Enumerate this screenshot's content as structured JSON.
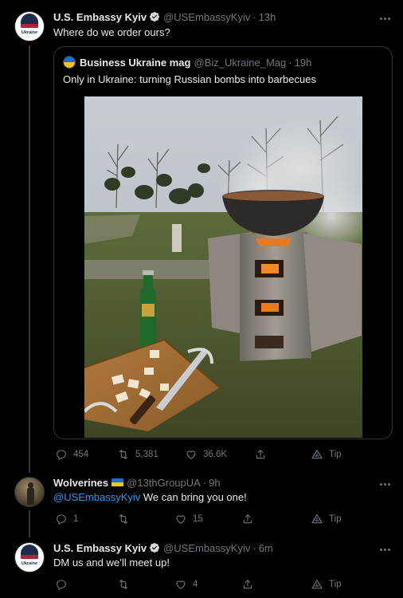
{
  "tweets": [
    {
      "name": "U.S. Embassy Kyiv",
      "handle": "@USEmbassyKyiv",
      "time": "13h",
      "text": "Where do we order ours?",
      "avatar_badge": "Ukraine",
      "quote": {
        "name": "Business Ukraine mag",
        "handle": "@Biz_Ukraine_Mag",
        "time": "19h",
        "text": "Only in Ukraine: turning Russian bombs into barbecues",
        "image": "photo-bomb-barbecue"
      },
      "stats": {
        "replies": "454",
        "retweets": "5,381",
        "likes": "36.6K",
        "tip": "Tip"
      }
    },
    {
      "name": "Wolverines",
      "handle": "@13thGroupUA",
      "time": "9h",
      "mention": "@USEmbassyKyiv",
      "text": " We can bring you one!",
      "stats": {
        "replies": "1",
        "retweets": "",
        "likes": "15",
        "tip": "Tip"
      }
    },
    {
      "name": "U.S. Embassy Kyiv",
      "handle": "@USEmbassyKyiv",
      "time": "6m",
      "text": "DM us and we’ll meet up!",
      "avatar_badge": "Ukraine",
      "stats": {
        "replies": "",
        "retweets": "",
        "likes": "4",
        "tip": "Tip"
      }
    }
  ],
  "colors": {
    "background": "#000000",
    "text": "#e7e9ea",
    "muted": "#71767b",
    "accent": "#1d9bf0",
    "verified": "#1d9bf0",
    "flag_blue": "#1d6fd8",
    "flag_yellow": "#f3c613"
  },
  "icons": [
    "verified-badge-icon",
    "more-icon",
    "reply-icon",
    "retweet-icon",
    "like-icon",
    "share-icon",
    "tip-icon",
    "ukraine-flag-icon"
  ]
}
